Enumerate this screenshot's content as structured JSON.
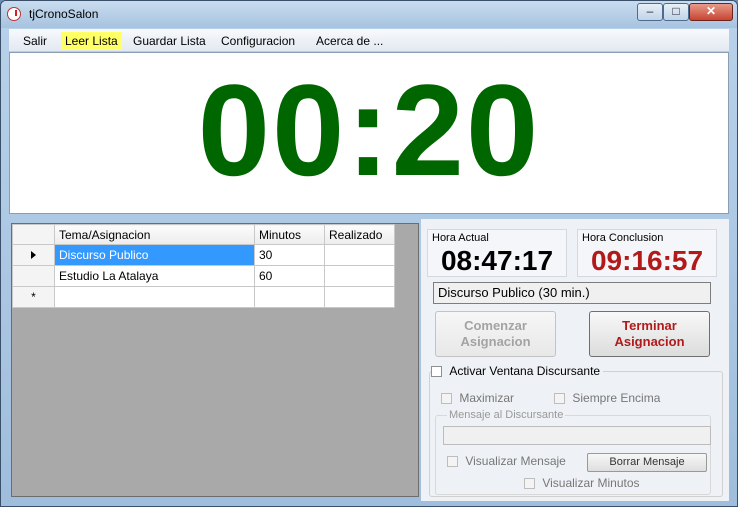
{
  "window": {
    "title": "tjCronoSalon"
  },
  "menu": {
    "items": [
      "Salir",
      "Leer Lista",
      "Guardar Lista",
      "Configuracion",
      "Acerca de ..."
    ],
    "highlight_color": "#ffff66"
  },
  "timer": {
    "value": "00:20",
    "color": "#006600"
  },
  "grid": {
    "headers": [
      "Tema/Asignacion",
      "Minutos",
      "Realizado"
    ],
    "rows": [
      {
        "tema": "Discurso Publico",
        "minutos": "30",
        "realizado": ""
      },
      {
        "tema": "Estudio La Atalaya",
        "minutos": "60",
        "realizado": ""
      }
    ],
    "new_row_marker": "*"
  },
  "times": {
    "actual_label": "Hora Actual",
    "actual": "08:47:17",
    "conclusion_label": "Hora Conclusion",
    "conclusion": "09:16:57",
    "conclusion_color": "#b21a1a"
  },
  "status_text": "Discurso Publico (30 min.)",
  "buttons": {
    "start": "Comenzar Asignacion",
    "stop": "Terminar Asignacion"
  },
  "options": {
    "activar": "Activar Ventana Discursante",
    "maximizar": "Maximizar",
    "siempre": "Siempre Encima",
    "mensaje_group": "Mensaje al Discursante",
    "visualizar_mensaje": "Visualizar Mensaje",
    "borrar_mensaje": "Borrar Mensaje",
    "visualizar_minutos": "Visualizar Minutos"
  }
}
